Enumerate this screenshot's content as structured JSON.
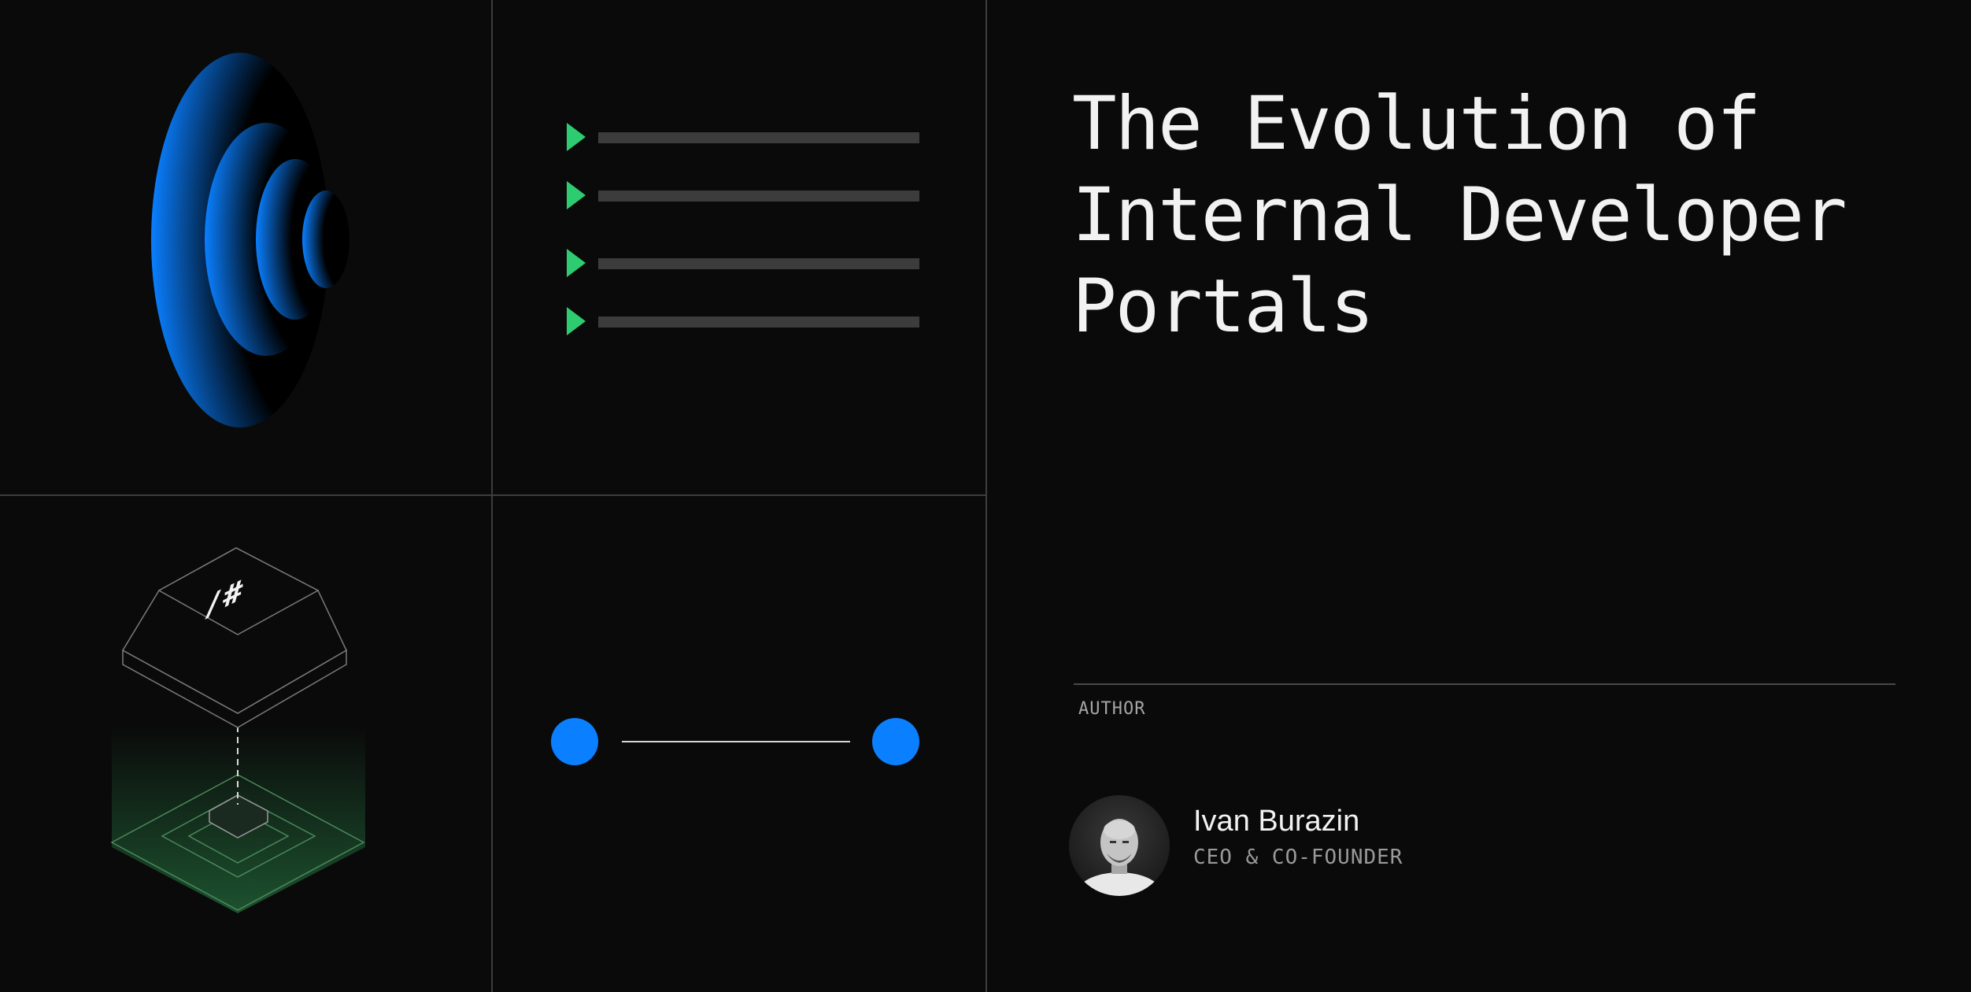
{
  "title_lines": [
    "The Evolution of",
    "Internal Developer",
    "Portals"
  ],
  "key_glyph": "/#",
  "author": {
    "label": "AUTHOR",
    "name": "Ivan Burazin",
    "role": "CEO & CO-FOUNDER"
  },
  "colors": {
    "background": "#0a0a0a",
    "accent_blue": "#0a7fff",
    "accent_green": "#2ecc71",
    "text": "#f2f2f2",
    "muted": "#9a9a9a"
  },
  "icons": [
    "concentric-rings-icon",
    "play-list-icon",
    "keycap-icon",
    "connector-icon",
    "avatar"
  ]
}
